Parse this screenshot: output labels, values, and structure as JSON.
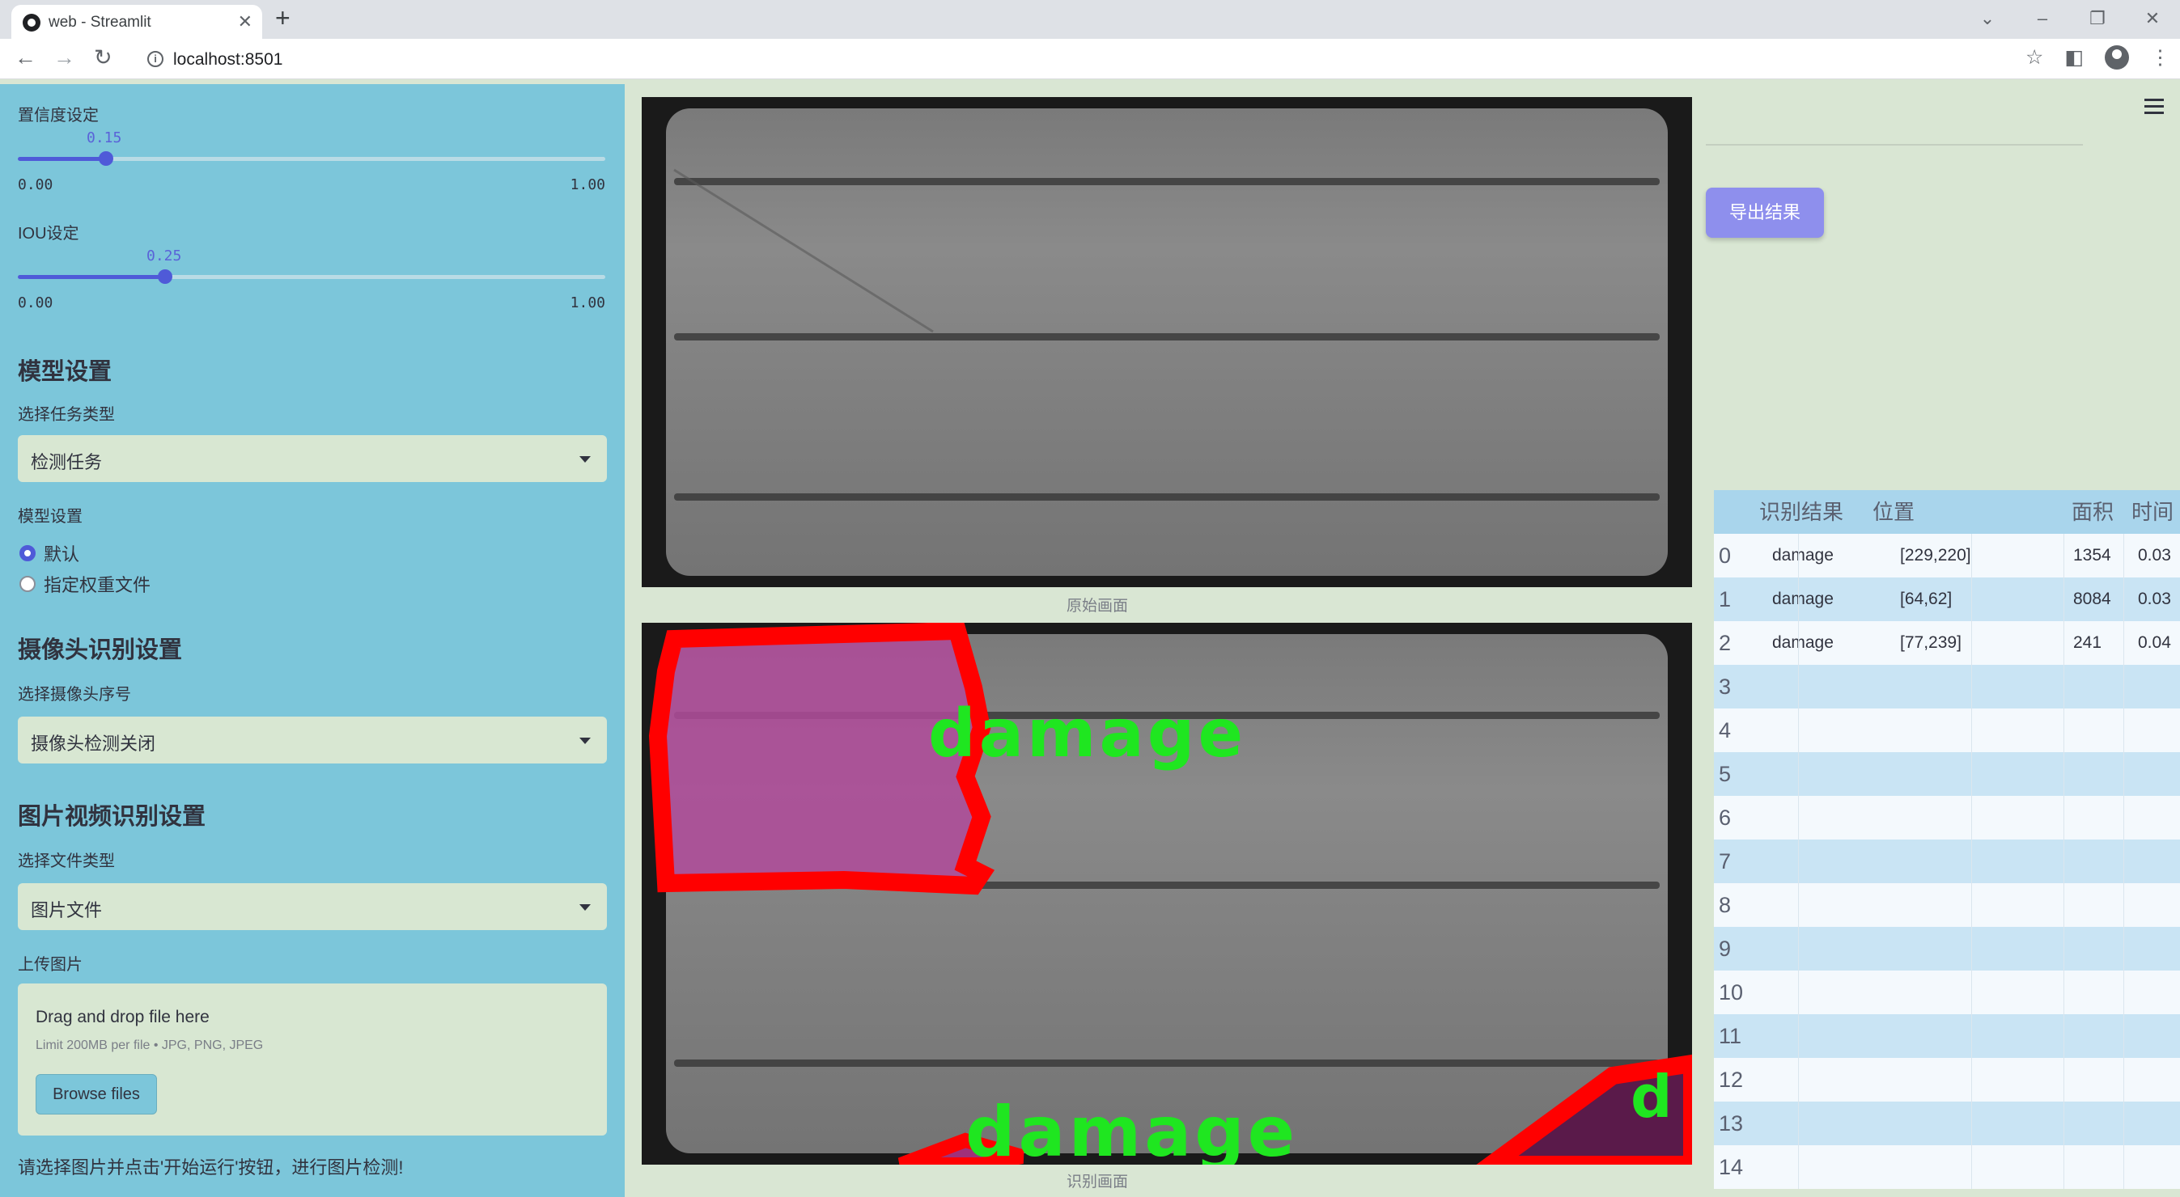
{
  "browser": {
    "tab_title": "web - Streamlit",
    "url": "localhost:8501"
  },
  "sidebar": {
    "confidence": {
      "label": "置信度设定",
      "value": "0.15",
      "min": "0.00",
      "max": "1.00",
      "fraction": 0.15
    },
    "iou": {
      "label": "IOU设定",
      "value": "0.25",
      "min": "0.00",
      "max": "1.00",
      "fraction": 0.25
    },
    "model_section_title": "模型设置",
    "task_type_label": "选择任务类型",
    "task_type_value": "检测任务",
    "model_setting_label": "模型设置",
    "model_options": [
      "默认",
      "指定权重文件"
    ],
    "model_selected": "默认",
    "camera_section_title": "摄像头识别设置",
    "camera_select_label": "选择摄像头序号",
    "camera_select_value": "摄像头检测关闭",
    "media_section_title": "图片视频识别设置",
    "file_type_label": "选择文件类型",
    "file_type_value": "图片文件",
    "upload_label": "上传图片",
    "upload_title": "Drag and drop file here",
    "upload_limit": "Limit 200MB per file • JPG, PNG, JPEG",
    "browse_label": "Browse files",
    "hint": "请选择图片并点击'开始运行'按钮，进行图片检测!"
  },
  "main": {
    "original_caption": "原始画面",
    "result_caption": "识别画面",
    "detection_label": "damage",
    "detection_label_partial": "d"
  },
  "right": {
    "export_label": "导出结果",
    "table": {
      "headers": [
        "识别结果",
        "位置",
        "面积",
        "时间"
      ],
      "rows": [
        {
          "idx": "0",
          "result": "damage",
          "pos": "[229,220]",
          "area": "1354",
          "time": "0.03"
        },
        {
          "idx": "1",
          "result": "damage",
          "pos": "[64,62]",
          "area": "8084",
          "time": "0.03"
        },
        {
          "idx": "2",
          "result": "damage",
          "pos": "[77,239]",
          "area": "241",
          "time": "0.04"
        },
        {
          "idx": "3"
        },
        {
          "idx": "4"
        },
        {
          "idx": "5"
        },
        {
          "idx": "6"
        },
        {
          "idx": "7"
        },
        {
          "idx": "8"
        },
        {
          "idx": "9"
        },
        {
          "idx": "10"
        },
        {
          "idx": "11"
        },
        {
          "idx": "12"
        },
        {
          "idx": "13"
        },
        {
          "idx": "14"
        }
      ]
    }
  },
  "colors": {
    "sidebar_bg": "#7cc6da",
    "accent": "#4f5ad8",
    "export_button": "#8e8fed",
    "detection_box": "#ff0000",
    "detection_text": "#1fe620"
  }
}
